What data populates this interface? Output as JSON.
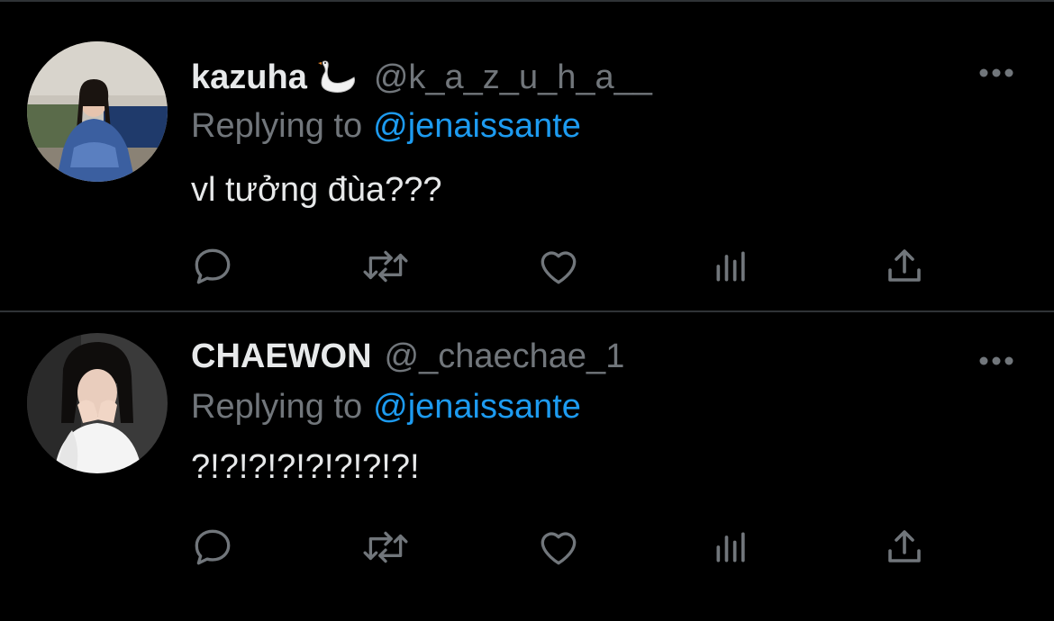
{
  "colors": {
    "background": "#000000",
    "divider": "#2f3336",
    "primary_text": "#e7e9ea",
    "secondary_text": "#71767b",
    "link": "#1d9bf0"
  },
  "tweets": [
    {
      "display_name": "kazuha",
      "name_emoji": "swan-icon",
      "handle": "@k_a_z_u_h_a__",
      "replying_label": "Replying to",
      "replying_to": "@jenaissante",
      "text": "vl tưởng đùa???",
      "actions": [
        "reply-icon",
        "retweet-icon",
        "like-icon",
        "views-icon",
        "share-icon"
      ]
    },
    {
      "display_name": "CHAEWON",
      "handle": "@_chaechae_1",
      "replying_label": "Replying to",
      "replying_to": "@jenaissante",
      "text": "?!?!?!?!?!?!?!?!",
      "actions": [
        "reply-icon",
        "retweet-icon",
        "like-icon",
        "views-icon",
        "share-icon"
      ]
    }
  ]
}
